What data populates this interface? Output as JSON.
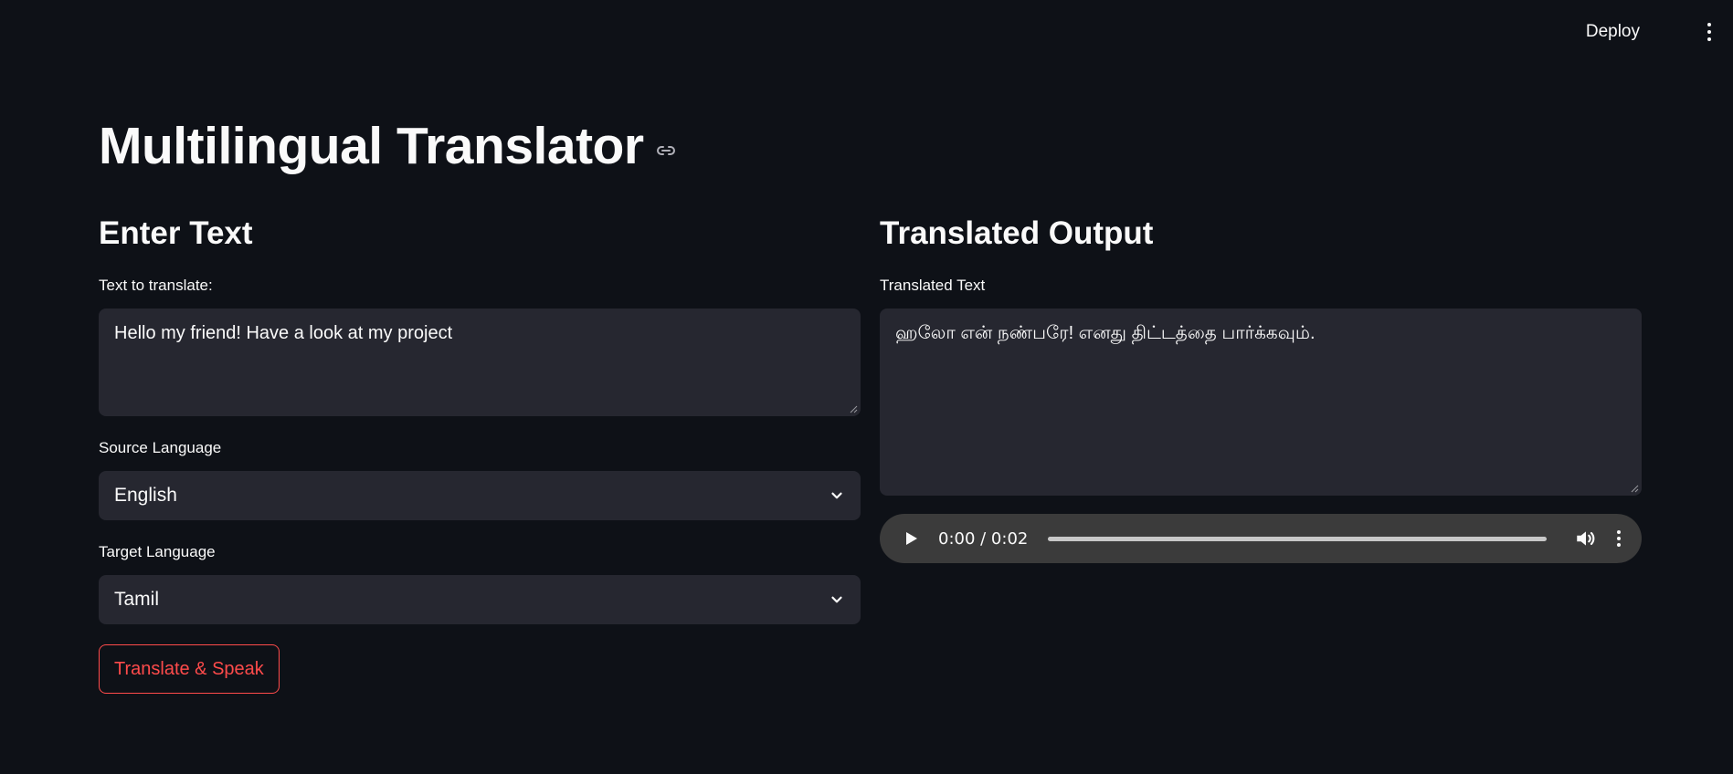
{
  "header": {
    "deploy_label": "Deploy"
  },
  "page": {
    "title": "Multilingual Translator"
  },
  "input_section": {
    "heading": "Enter Text",
    "text_label": "Text to translate:",
    "text_value": "Hello my friend! Have a look at my project",
    "source_label": "Source Language",
    "source_value": "English",
    "target_label": "Target Language",
    "target_value": "Tamil",
    "translate_button": "Translate & Speak"
  },
  "output_section": {
    "heading": "Translated Output",
    "text_label": "Translated Text",
    "text_value": "ஹலோ என் நண்பரே! எனது திட்டத்தை பார்க்கவும்.",
    "audio": {
      "time": "0:00 / 0:02",
      "progress": 0
    }
  },
  "colors": {
    "background": "#0e1117",
    "input_bg": "#262730",
    "accent": "#ff4b4b",
    "audio_bg": "#3b3b3b"
  }
}
